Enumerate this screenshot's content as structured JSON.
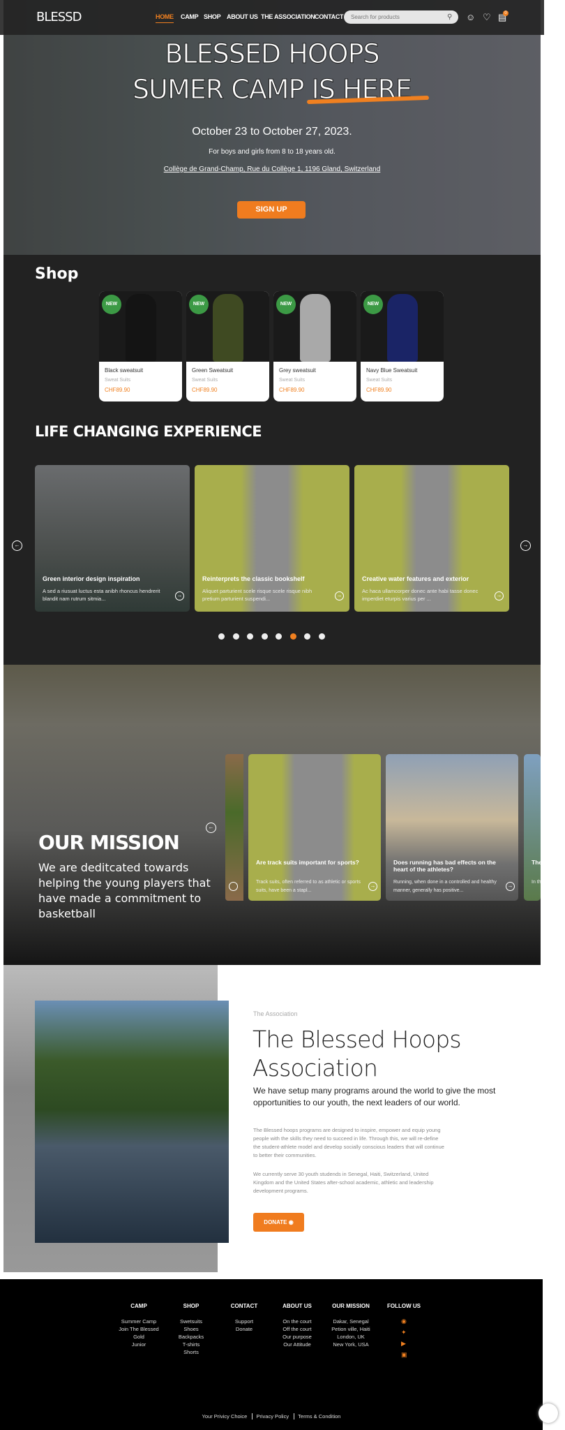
{
  "header": {
    "logo": "BLESSD",
    "nav": [
      "HOME",
      "CAMP",
      "SHOP",
      "ABOUT US",
      "THE ASSOCIATION",
      "CONTACT"
    ],
    "search_placeholder": "Search for products",
    "cart_count": "0",
    "accent": "#f08020"
  },
  "hero": {
    "title_line1": "BLESSED HOOPS",
    "title_line2": "SUMER CAMP IS HERE",
    "dates": "October 23 to October 27, 2023.",
    "audience": "For boys and girls from 8 to 18 years old.",
    "address": "Collège de Grand-Champ,  Rue du Collège 1, 1196 Gland, Switzerland",
    "cta": "SIGN UP"
  },
  "shop": {
    "title": "Shop",
    "badge": "NEW",
    "products": [
      {
        "name": "Black sweatsuit",
        "category": "Sweat Suits",
        "price": "CHF89.90",
        "color": "#141414"
      },
      {
        "name": "Green Sweatsuit",
        "category": "Sweat Suits",
        "price": "CHF89.90",
        "color": "#3f4a22"
      },
      {
        "name": "Grey sweatsuit",
        "category": "Sweat Suits",
        "price": "CHF89.90",
        "color": "#a9a9a9"
      },
      {
        "name": "Navy Blue Sweatsuit",
        "category": "Sweat Suits",
        "price": "CHF89.90",
        "color": "#1a2466"
      }
    ]
  },
  "experience": {
    "title": "LIFE CHANGING EXPERIENCE",
    "cards": [
      {
        "title": "Green interior design inspiration",
        "desc": "A sed a riusuat luctus esta anibh rhoncus hendrerit blandit nam rutrum sitmia..."
      },
      {
        "title": "Reinterprets the classic bookshelf",
        "desc": "Aliquet parturient scele risque scele risque nibh pretium parturient suspendi..."
      },
      {
        "title": "Creative water features and exterior",
        "desc": "Ac haca ullamcorper donec ante habi tasse donec imperdiet eturpis varius per ..."
      }
    ],
    "dots": 8,
    "active_dot": 6
  },
  "mission": {
    "title": "OUR MISSION",
    "text": "We are deditcated towards helping the young players that have made a commitment to basketball",
    "cards": [
      {
        "title": "Are track suits important for sports?",
        "desc": "Track suits, often referred to as athletic or sports suits, have been a stapl..."
      },
      {
        "title": "Does running has bad effects on the heart of the athletes?",
        "desc": "Running, when done in a controlled and healthy manner, generally has positive..."
      },
      {
        "title": "The A G",
        "desc": "In th incr"
      }
    ]
  },
  "association": {
    "eyebrow": "The Association",
    "title": "The Blessed Hoops Association",
    "subtitle": "We have setup many programs around the world to give the most opportunities to our youth, the next leaders of our world.",
    "p1": "The Blessed hoops programs are designed to inspire, empower and equip young people with the skills they need to succeed in life. Through this, we will re-define the student-athlete model and develop socially conscious leaders that will continue to better their communities.",
    "p2": "We currently serve 30 youth studends in Senegal, Haiti, Switzerland, United Kingdom and the United States after-school academic, athletic and leadership development programs.",
    "cta": "DONATE"
  },
  "footer": {
    "columns": [
      {
        "title": "CAMP",
        "links": [
          "Summer Camp",
          "Join The Blessed",
          "Gold",
          "Junior"
        ]
      },
      {
        "title": "SHOP",
        "links": [
          "Swetsuits",
          "Shoes",
          "Backpacks",
          "T-shirts",
          "Shorts"
        ]
      },
      {
        "title": "CONTACT",
        "links": [
          "Support",
          "Donate"
        ]
      },
      {
        "title": "ABOUT US",
        "links": [
          "On the court",
          "Off the court",
          "Our purpose",
          "Our Attitude"
        ]
      },
      {
        "title": "OUR MISSION",
        "links": [
          "Dakar, Senegal",
          "Petion ville, Haiti",
          "London, UK",
          "New York, USA"
        ]
      }
    ],
    "follow_title": "FOLLOW US",
    "social": [
      "facebook-icon",
      "twitter-icon",
      "youtube-icon",
      "instagram-icon"
    ],
    "legal": [
      "Your Privicy Choice",
      "Privacy Policy",
      "Terms & Condition"
    ]
  }
}
